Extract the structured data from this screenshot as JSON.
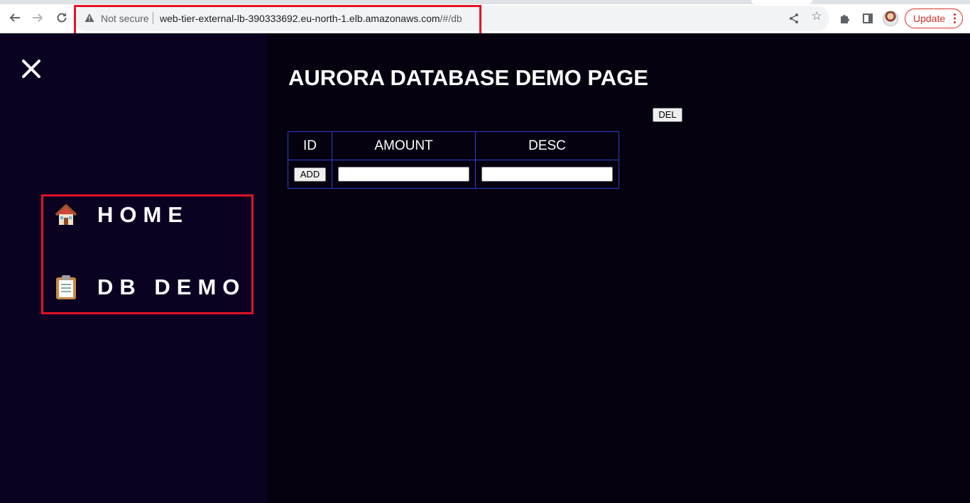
{
  "browser": {
    "security_label": "Not secure",
    "url_host": "web-tier-external-lb-390333692.eu-north-1.elb.amazonaws.com",
    "url_path": "/#/db",
    "update_label": "Update",
    "icons": {
      "back": "arrow-left-icon",
      "forward": "arrow-right-icon",
      "reload": "reload-icon",
      "warning": "warning-triangle-icon",
      "share": "share-icon",
      "star": "star-icon",
      "extensions": "puzzle-icon",
      "side_panel": "side-panel-icon",
      "menu": "kebab-menu-icon"
    }
  },
  "sidebar": {
    "close_icon": "close-icon",
    "items": [
      {
        "icon": "🏠",
        "icon_name": "house-icon",
        "label": "HOME"
      },
      {
        "icon": "📋",
        "icon_name": "clipboard-icon",
        "label": "DB DEMO"
      }
    ]
  },
  "main": {
    "title": "AURORA DATABASE DEMO PAGE",
    "del_label": "DEL",
    "table": {
      "headers": [
        "ID",
        "AMOUNT",
        "DESC"
      ],
      "add_label": "ADD",
      "amount_value": "",
      "desc_value": ""
    }
  },
  "colors": {
    "sidebar_bg": "#0b0222",
    "main_bg": "#05010f",
    "highlight_border": "#e11226",
    "table_border": "#2a3fd6",
    "update_accent": "#d93025"
  }
}
